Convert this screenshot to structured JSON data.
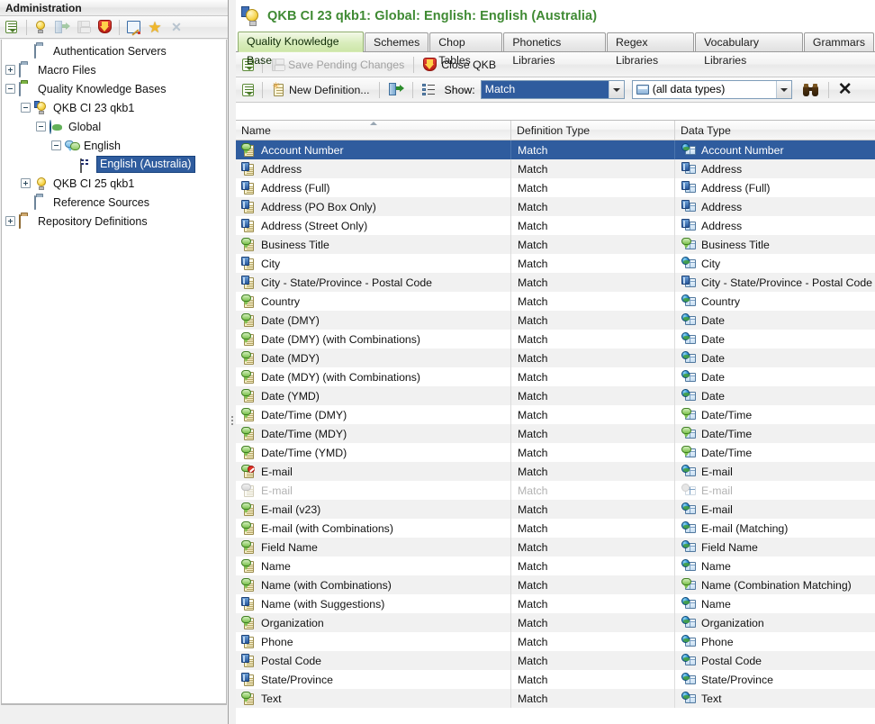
{
  "left_panel": {
    "title": "Administration",
    "toolbar": [
      {
        "name": "menu-button",
        "icon": "list-menu-icon",
        "disabled": false
      },
      {
        "name": "new-qkb-button",
        "icon": "bulb-add-icon",
        "disabled": false
      },
      {
        "name": "open-button",
        "icon": "open-door-icon",
        "disabled": true
      },
      {
        "name": "save-button",
        "icon": "save-icon",
        "disabled": true
      },
      {
        "name": "close-qkb-button",
        "icon": "shield-down-icon",
        "disabled": false
      },
      {
        "name": "edit-button",
        "icon": "pencil-box-icon",
        "disabled": false
      },
      {
        "name": "favorite-button",
        "icon": "star-icon",
        "disabled": false
      },
      {
        "name": "delete-button",
        "icon": "delete-x-icon",
        "disabled": true
      }
    ],
    "tree": [
      {
        "label": "Authentication Servers",
        "indent": 1,
        "expander": "none",
        "icon": "folder-blue-icon",
        "selected": false
      },
      {
        "label": "Macro Files",
        "indent": 0,
        "expander": "plus",
        "icon": "folder-blue-icon",
        "selected": false
      },
      {
        "label": "Quality Knowledge Bases",
        "indent": 0,
        "expander": "minus",
        "icon": "folder-green-icon",
        "selected": false
      },
      {
        "label": "QKB CI 23 qkb1",
        "indent": 1,
        "expander": "minus",
        "icon": "bulb-flag-icon",
        "selected": false
      },
      {
        "label": "Global",
        "indent": 2,
        "expander": "minus",
        "icon": "globe-icon",
        "selected": false
      },
      {
        "label": "English",
        "indent": 3,
        "expander": "minus",
        "icon": "speech-icon",
        "selected": false
      },
      {
        "label": "English (Australia)",
        "indent": 4,
        "expander": "none",
        "icon": "flag-au-icon",
        "selected": true
      },
      {
        "label": "QKB CI 25 qkb1",
        "indent": 1,
        "expander": "plus",
        "icon": "bulb-icon",
        "selected": false
      },
      {
        "label": "Reference Sources",
        "indent": 1,
        "expander": "none",
        "icon": "folder-blue-icon",
        "selected": false
      },
      {
        "label": "Repository Definitions",
        "indent": 0,
        "expander": "plus",
        "icon": "folder-brown-icon",
        "selected": false
      }
    ]
  },
  "document": {
    "title": "QKB CI 23 qkb1: Global: English: English (Australia)",
    "title_color": "#3f8a33",
    "title_icon": "bulb-flag-icon"
  },
  "tabs": [
    {
      "label": "Quality Knowledge Base",
      "active": true
    },
    {
      "label": "Schemes",
      "active": false
    },
    {
      "label": "Chop Tables",
      "active": false
    },
    {
      "label": "Phonetics Libraries",
      "active": false
    },
    {
      "label": "Regex Libraries",
      "active": false
    },
    {
      "label": "Vocabulary Libraries",
      "active": false
    },
    {
      "label": "Grammars",
      "active": false
    }
  ],
  "toolbar_primary": {
    "menu_icon": "toolbar-menu-icon",
    "save_pending": {
      "label": "Save Pending Changes",
      "icon": "save-icon",
      "disabled": true
    },
    "close_qkb": {
      "label": "Close QKB",
      "icon": "shield-down-icon",
      "disabled": false
    }
  },
  "toolbar_secondary": {
    "menu_icon": "toolbar-menu-icon",
    "new_definition": {
      "label": "New Definition...",
      "icon": "new-definition-icon"
    },
    "export_icon": "export-icon",
    "properties_icon": "properties-list-icon",
    "show_label": "Show:",
    "definition_type_combo": {
      "value": "Match",
      "selected": true
    },
    "data_type_combo": {
      "value": "(all data types)",
      "icon": "data-type-icon",
      "selected": false
    },
    "find_icon": "binoculars-icon",
    "clear_icon": "close-x-icon"
  },
  "grid": {
    "columns": [
      {
        "key": "name",
        "label": "Name",
        "sorted": true
      },
      {
        "key": "definition_type",
        "label": "Definition Type",
        "sorted": false
      },
      {
        "key": "data_type",
        "label": "Data Type",
        "sorted": false
      }
    ],
    "selected_color": "#2f5c9e",
    "rows": [
      {
        "name": "Account Number",
        "definition_type": "Match",
        "data_type": "Account Number",
        "name_badge": "speech",
        "dt_badge": "globe",
        "selected": true,
        "disabled": false
      },
      {
        "name": "Address",
        "definition_type": "Match",
        "data_type": "Address",
        "name_badge": "flag",
        "dt_badge": "flag",
        "selected": false,
        "disabled": false
      },
      {
        "name": "Address (Full)",
        "definition_type": "Match",
        "data_type": "Address (Full)",
        "name_badge": "flag",
        "dt_badge": "flag",
        "selected": false,
        "disabled": false
      },
      {
        "name": "Address (PO Box Only)",
        "definition_type": "Match",
        "data_type": "Address",
        "name_badge": "flag",
        "dt_badge": "flag",
        "selected": false,
        "disabled": false
      },
      {
        "name": "Address (Street Only)",
        "definition_type": "Match",
        "data_type": "Address",
        "name_badge": "flag",
        "dt_badge": "flag",
        "selected": false,
        "disabled": false
      },
      {
        "name": "Business Title",
        "definition_type": "Match",
        "data_type": "Business Title",
        "name_badge": "speech",
        "dt_badge": "speech",
        "selected": false,
        "disabled": false
      },
      {
        "name": "City",
        "definition_type": "Match",
        "data_type": "City",
        "name_badge": "flag",
        "dt_badge": "globe",
        "selected": false,
        "disabled": false
      },
      {
        "name": "City - State/Province - Postal Code",
        "definition_type": "Match",
        "data_type": "City - State/Province - Postal Code",
        "name_badge": "flag",
        "dt_badge": "flag",
        "selected": false,
        "disabled": false
      },
      {
        "name": "Country",
        "definition_type": "Match",
        "data_type": "Country",
        "name_badge": "speech",
        "dt_badge": "globe",
        "selected": false,
        "disabled": false
      },
      {
        "name": "Date (DMY)",
        "definition_type": "Match",
        "data_type": "Date",
        "name_badge": "speech",
        "dt_badge": "globe",
        "selected": false,
        "disabled": false
      },
      {
        "name": "Date (DMY) (with Combinations)",
        "definition_type": "Match",
        "data_type": "Date",
        "name_badge": "speech",
        "dt_badge": "globe",
        "selected": false,
        "disabled": false
      },
      {
        "name": "Date (MDY)",
        "definition_type": "Match",
        "data_type": "Date",
        "name_badge": "speech",
        "dt_badge": "globe",
        "selected": false,
        "disabled": false
      },
      {
        "name": "Date (MDY) (with Combinations)",
        "definition_type": "Match",
        "data_type": "Date",
        "name_badge": "speech",
        "dt_badge": "globe",
        "selected": false,
        "disabled": false
      },
      {
        "name": "Date (YMD)",
        "definition_type": "Match",
        "data_type": "Date",
        "name_badge": "speech",
        "dt_badge": "globe",
        "selected": false,
        "disabled": false
      },
      {
        "name": "Date/Time (DMY)",
        "definition_type": "Match",
        "data_type": "Date/Time",
        "name_badge": "speech",
        "dt_badge": "speech",
        "selected": false,
        "disabled": false
      },
      {
        "name": "Date/Time (MDY)",
        "definition_type": "Match",
        "data_type": "Date/Time",
        "name_badge": "speech",
        "dt_badge": "speech",
        "selected": false,
        "disabled": false
      },
      {
        "name": "Date/Time (YMD)",
        "definition_type": "Match",
        "data_type": "Date/Time",
        "name_badge": "speech",
        "dt_badge": "speech",
        "selected": false,
        "disabled": false
      },
      {
        "name": "E-mail",
        "definition_type": "Match",
        "data_type": "E-mail",
        "name_badge": "error",
        "dt_badge": "globe",
        "selected": false,
        "disabled": false
      },
      {
        "name": "E-mail",
        "definition_type": "Match",
        "data_type": "E-mail",
        "name_badge": "gray",
        "dt_badge": "graydot",
        "selected": false,
        "disabled": true
      },
      {
        "name": "E-mail (v23)",
        "definition_type": "Match",
        "data_type": "E-mail",
        "name_badge": "speech",
        "dt_badge": "globe",
        "selected": false,
        "disabled": false
      },
      {
        "name": "E-mail (with Combinations)",
        "definition_type": "Match",
        "data_type": "E-mail (Matching)",
        "name_badge": "speech",
        "dt_badge": "globe",
        "selected": false,
        "disabled": false
      },
      {
        "name": "Field Name",
        "definition_type": "Match",
        "data_type": "Field Name",
        "name_badge": "speech",
        "dt_badge": "globe",
        "selected": false,
        "disabled": false
      },
      {
        "name": "Name",
        "definition_type": "Match",
        "data_type": "Name",
        "name_badge": "speech",
        "dt_badge": "globe",
        "selected": false,
        "disabled": false
      },
      {
        "name": "Name (with Combinations)",
        "definition_type": "Match",
        "data_type": "Name (Combination Matching)",
        "name_badge": "speech",
        "dt_badge": "speech",
        "selected": false,
        "disabled": false
      },
      {
        "name": "Name (with Suggestions)",
        "definition_type": "Match",
        "data_type": "Name",
        "name_badge": "flag",
        "dt_badge": "globe",
        "selected": false,
        "disabled": false
      },
      {
        "name": "Organization",
        "definition_type": "Match",
        "data_type": "Organization",
        "name_badge": "speech",
        "dt_badge": "globe",
        "selected": false,
        "disabled": false
      },
      {
        "name": "Phone",
        "definition_type": "Match",
        "data_type": "Phone",
        "name_badge": "flag",
        "dt_badge": "globe",
        "selected": false,
        "disabled": false
      },
      {
        "name": "Postal Code",
        "definition_type": "Match",
        "data_type": "Postal Code",
        "name_badge": "flag",
        "dt_badge": "globe",
        "selected": false,
        "disabled": false
      },
      {
        "name": "State/Province",
        "definition_type": "Match",
        "data_type": "State/Province",
        "name_badge": "flag",
        "dt_badge": "globe",
        "selected": false,
        "disabled": false
      },
      {
        "name": "Text",
        "definition_type": "Match",
        "data_type": "Text",
        "name_badge": "speech",
        "dt_badge": "globe",
        "selected": false,
        "disabled": false
      }
    ]
  }
}
